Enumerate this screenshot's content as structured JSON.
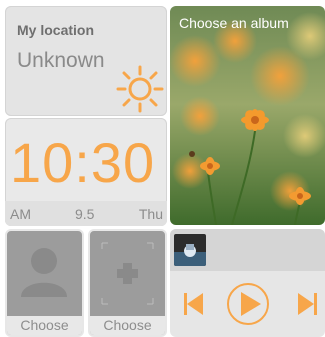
{
  "weather": {
    "title": "My location",
    "value": "Unknown",
    "icon": "sun-icon"
  },
  "clock": {
    "time": "10:30",
    "ampm": "AM",
    "date": "9.5",
    "day": "Thu"
  },
  "album": {
    "label": "Choose an album"
  },
  "contacts": [
    {
      "label": "Choose",
      "icon": "person-icon"
    },
    {
      "label": "Choose",
      "icon": "add-icon"
    }
  ],
  "music": {
    "thumbnail": "album-thumbnail",
    "controls": [
      "previous-icon",
      "play-icon",
      "next-icon"
    ]
  },
  "colors": {
    "accent": "#f7a64a",
    "tile_gray": "#e4e4e4",
    "contact_gray": "#9c9c9c"
  }
}
